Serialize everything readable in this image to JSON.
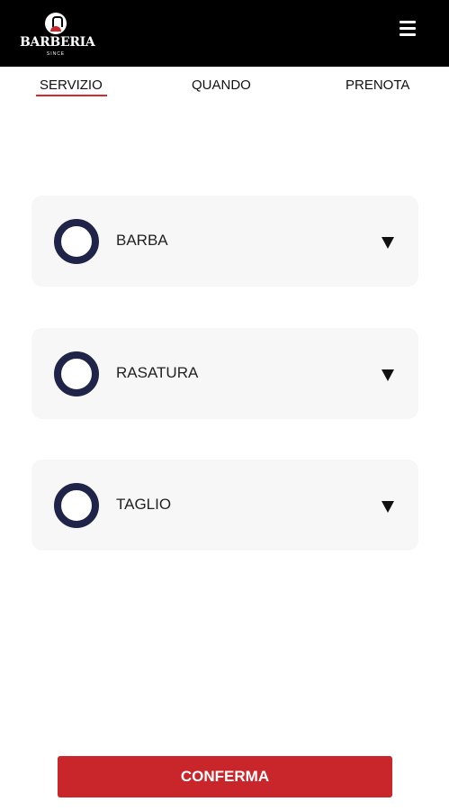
{
  "header": {
    "logo": {
      "title": "BARBERIA",
      "subtitle": "SINCE"
    },
    "menu_icon": "hamburger-menu-icon"
  },
  "tabs": [
    {
      "label": "SERVIZIO",
      "active": true
    },
    {
      "label": "QUANDO",
      "active": false
    },
    {
      "label": "PRENOTA",
      "active": false
    }
  ],
  "services": [
    {
      "label": "BARBA",
      "selected": false,
      "icon": "radio-circle-icon",
      "expand_icon": "caret-down-icon"
    },
    {
      "label": "RASATURA",
      "selected": false,
      "icon": "radio-circle-icon",
      "expand_icon": "caret-down-icon"
    },
    {
      "label": "TAGLIO",
      "selected": false,
      "icon": "radio-circle-icon",
      "expand_icon": "caret-down-icon"
    }
  ],
  "confirm_button": {
    "label": "CONFERMA"
  },
  "colors": {
    "header_bg": "#000000",
    "accent_red": "#c8262a",
    "radio_navy": "#1f2448",
    "card_bg": "#f7f7f7"
  }
}
